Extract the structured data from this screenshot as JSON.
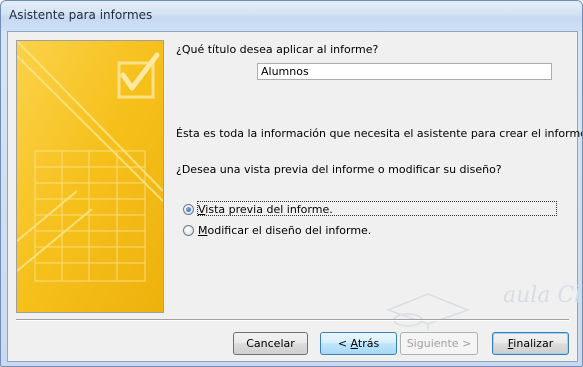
{
  "window": {
    "title": "Asistente para informes"
  },
  "wizard": {
    "title_question": "¿Qué título desea aplicar al informe?",
    "report_title_value": "Alumnos",
    "info_text": "Ésta es toda la información que necesita el asistente para crear el informe.",
    "preview_question": "¿Desea una vista previa del informe o modificar su diseño?",
    "options": [
      {
        "mnemonic": "V",
        "rest": "ista previa del informe.",
        "checked": true
      },
      {
        "mnemonic": "M",
        "rest": "odificar el diseño del informe.",
        "checked": false
      }
    ]
  },
  "buttons": {
    "cancel": "Cancelar",
    "back_prefix": "< ",
    "back_mnemonic": "A",
    "back_rest": "trás",
    "next": "Siguiente >",
    "finish_mnemonic": "F",
    "finish_rest": "inalizar"
  },
  "watermark": {
    "text": "aula Clic"
  },
  "colors": {
    "accent": "#3c7fb1",
    "side_image_yellow": "#f7c21c",
    "title_bar": "#d3e2f4"
  }
}
